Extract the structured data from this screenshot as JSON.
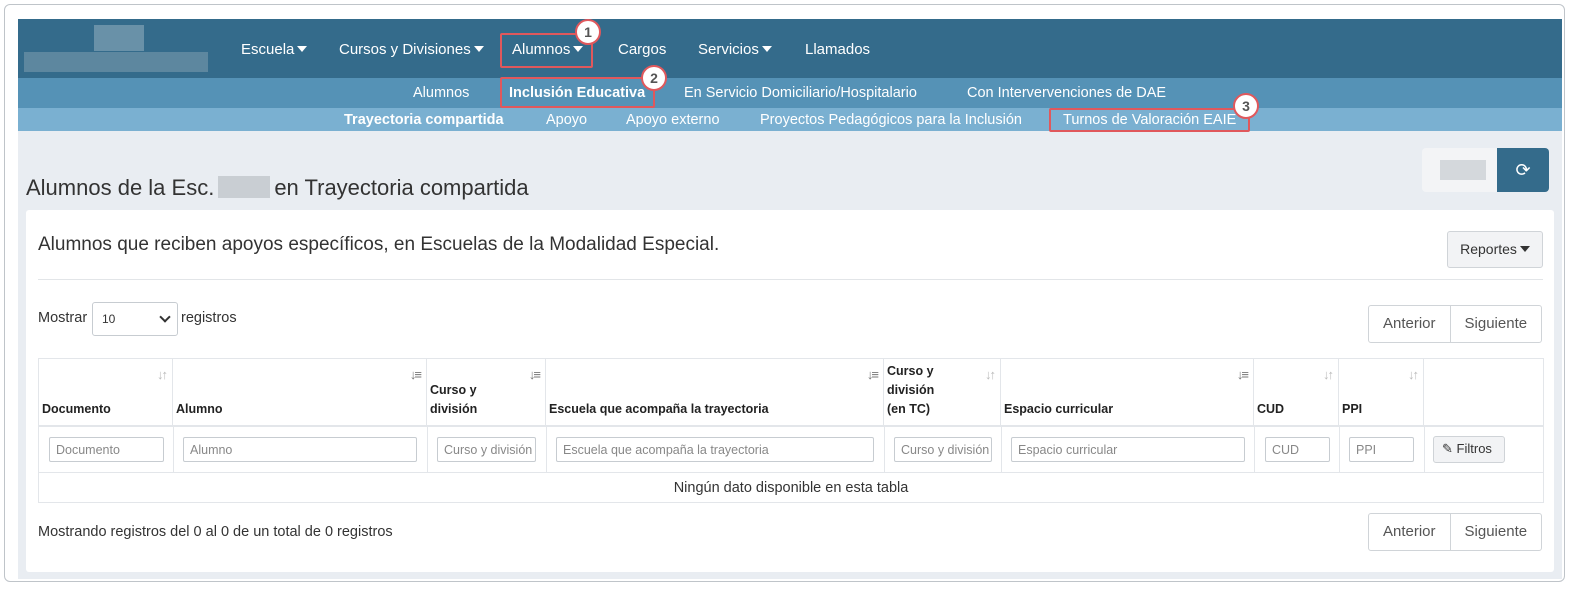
{
  "nav": {
    "top": [
      {
        "label": "Escuela",
        "caret": true
      },
      {
        "label": "Cursos y Divisiones",
        "caret": true
      },
      {
        "label": "Alumnos",
        "caret": true
      },
      {
        "label": "Cargos",
        "caret": false
      },
      {
        "label": "Servicios",
        "caret": true
      },
      {
        "label": "Llamados",
        "caret": false
      }
    ],
    "second": [
      "Alumnos",
      "Inclusión Educativa",
      "En Servicio Domiciliario/Hospitalario",
      "Con Intervervenciones de DAE"
    ],
    "third": [
      "Trayectoria compartida",
      "Apoyo",
      "Apoyo externo",
      "Proyectos Pedagógicos para la Inclusión",
      "Turnos de Valoración EAIE"
    ]
  },
  "callouts": [
    "1",
    "2",
    "3"
  ],
  "page": {
    "title_prefix": "Alumnos de la Esc.",
    "title_suffix": "en Trayectoria compartida",
    "refresh_icon": "refresh-icon"
  },
  "card": {
    "subtitle": "Alumnos que reciben apoyos específicos, en Escuelas de la Modalidad Especial.",
    "reportes": "Reportes",
    "mostrar": "Mostrar",
    "page_size": "10",
    "registros": "registros",
    "prev": "Anterior",
    "next": "Siguiente",
    "empty": "Ningún dato disponible en esta tabla",
    "footer": "Mostrando registros del 0 al 0 de un total de 0 registros"
  },
  "table": {
    "headers": [
      "Documento",
      "Alumno",
      "Curso y\ndivisión",
      "Escuela que acompaña la trayectoria",
      "Curso y\ndivisión\n(en TC)",
      "Espacio curricular",
      "CUD",
      "PPI"
    ],
    "filters": [
      "Documento",
      "Alumno",
      "Curso y división",
      "Escuela que acompaña la trayectoria",
      "Curso y división",
      "Espacio curricular",
      "CUD",
      "PPI"
    ],
    "filter_button": "Filtros",
    "colors": {
      "accent": "#346b8b",
      "highlight": "#e0585c"
    }
  }
}
